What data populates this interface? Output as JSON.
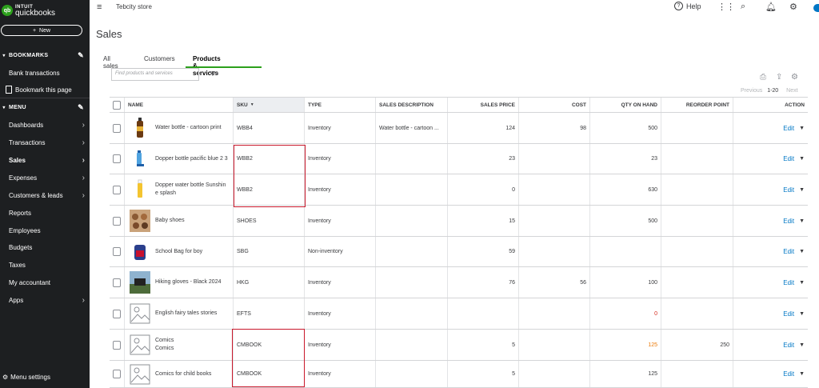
{
  "sidebar": {
    "logo_brand": "INTUIT",
    "logo_product": "quickbooks",
    "new_button": "New",
    "bookmarks_label": "BOOKMARKS",
    "bank_transactions": "Bank transactions",
    "bookmark_this_page": "Bookmark this page",
    "menu_label": "MENU",
    "items": [
      {
        "label": "Dashboards",
        "arrow": true
      },
      {
        "label": "Transactions",
        "arrow": true
      },
      {
        "label": "Sales",
        "arrow": true,
        "active": true
      },
      {
        "label": "Expenses",
        "arrow": true
      },
      {
        "label": "Customers & leads",
        "arrow": true
      },
      {
        "label": "Reports",
        "arrow": false
      },
      {
        "label": "Employees",
        "arrow": false
      },
      {
        "label": "Budgets",
        "arrow": false
      },
      {
        "label": "Taxes",
        "arrow": false
      },
      {
        "label": "My accountant",
        "arrow": false
      },
      {
        "label": "Apps",
        "arrow": true
      }
    ],
    "menu_settings": "Menu settings"
  },
  "topbar": {
    "company": "Tebcity store",
    "help": "Help"
  },
  "page": {
    "title": "Sales",
    "tabs": [
      "All sales",
      "Customers",
      "Products & services"
    ],
    "active_tab": "Products & services",
    "search_placeholder": "Find products and services",
    "pager_previous": "Previous",
    "pager_range": "1-20",
    "pager_next": "Next"
  },
  "table": {
    "headers": {
      "name": "NAME",
      "sku": "SKU",
      "type": "TYPE",
      "desc": "SALES DESCRIPTION",
      "price": "SALES PRICE",
      "cost": "COST",
      "qty": "QTY ON HAND",
      "reorder": "REORDER POINT",
      "action": "ACTION"
    },
    "rows": [
      {
        "name": "Water bottle - cartoon print",
        "sku": "WBB4",
        "type": "Inventory",
        "desc": "Water bottle - cartoon ...",
        "price": "124",
        "cost": "98",
        "qty": "500",
        "reorder": "",
        "action": "Edit",
        "thumb": "bottle-dark"
      },
      {
        "name": "Dopper bottle pacific blue 2 3",
        "sku": "WBB2",
        "type": "Inventory",
        "desc": "",
        "price": "23",
        "cost": "",
        "qty": "23",
        "reorder": "",
        "action": "Edit",
        "thumb": "bottle-blue"
      },
      {
        "name": "Dopper water bottle Sunshin e splash",
        "sku": "WBB2",
        "type": "Inventory",
        "desc": "",
        "price": "0",
        "cost": "",
        "qty": "630",
        "reorder": "",
        "action": "Edit",
        "thumb": "bottle-yellow"
      },
      {
        "name": "Baby shoes",
        "sku": "SHOES",
        "type": "Inventory",
        "desc": "",
        "price": "15",
        "cost": "",
        "qty": "500",
        "reorder": "",
        "action": "Edit",
        "thumb": "photo-shoes"
      },
      {
        "name": "School Bag for boy",
        "sku": "SBG",
        "type": "Non-inventory",
        "desc": "",
        "price": "59",
        "cost": "",
        "qty": "",
        "reorder": "",
        "action": "Edit",
        "thumb": "photo-bag"
      },
      {
        "name": "Hiking gloves - Black 2024",
        "sku": "HKG",
        "type": "Inventory",
        "desc": "",
        "price": "76",
        "cost": "56",
        "qty": "100",
        "reorder": "",
        "action": "Edit",
        "thumb": "photo-gloves"
      },
      {
        "name": "English fairy tales stories",
        "sku": "EFTS",
        "type": "Inventory",
        "desc": "",
        "price": "",
        "cost": "",
        "qty": "0",
        "qty_status": "red",
        "reorder": "",
        "action": "Edit",
        "thumb": "placeholder"
      },
      {
        "name": "Comics\nComics",
        "sku": "CMBOOK",
        "type": "Inventory",
        "desc": "",
        "price": "5",
        "cost": "",
        "qty": "125",
        "qty_status": "orange",
        "reorder": "250",
        "action": "Edit",
        "thumb": "placeholder"
      },
      {
        "name": "Comics for child books",
        "sku": "CMBOOK",
        "type": "Inventory",
        "desc": "",
        "price": "5",
        "cost": "",
        "qty": "125",
        "reorder": "",
        "action": "Edit",
        "thumb": "placeholder"
      }
    ]
  },
  "colors": {
    "accent": "#2ca01c",
    "link": "#0077c5",
    "highlight": "#c9182b"
  }
}
